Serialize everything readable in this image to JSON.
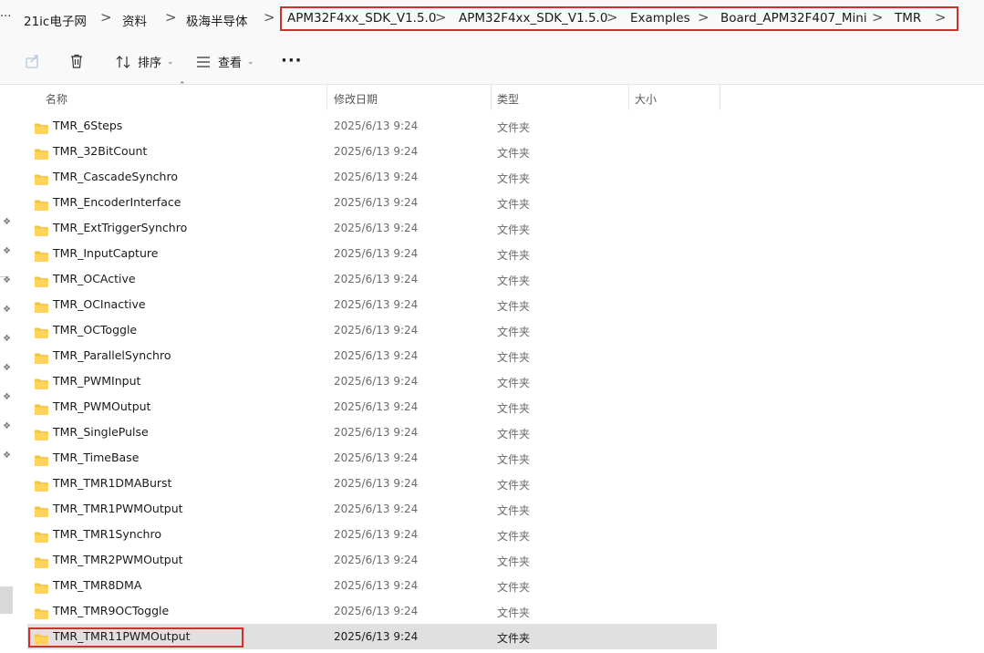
{
  "breadcrumb": {
    "overflow": "···",
    "items": [
      "21ic电子网",
      "资料",
      "极海半导体",
      "APM32F4xx_SDK_V1.5.0",
      "APM32F4xx_SDK_V1.5.0",
      "Examples",
      "Board_APM32F407_Mini",
      "TMR"
    ],
    "separator": ">"
  },
  "toolbar": {
    "sort_label": "排序",
    "view_label": "查看",
    "more_label": "···"
  },
  "columns": {
    "name": "名称",
    "modified": "修改日期",
    "type": "类型",
    "size": "大小"
  },
  "files": [
    {
      "name": "TMR_6Steps",
      "date": "2025/6/13 9:24",
      "type": "文件夹"
    },
    {
      "name": "TMR_32BitCount",
      "date": "2025/6/13 9:24",
      "type": "文件夹"
    },
    {
      "name": "TMR_CascadeSynchro",
      "date": "2025/6/13 9:24",
      "type": "文件夹"
    },
    {
      "name": "TMR_EncoderInterface",
      "date": "2025/6/13 9:24",
      "type": "文件夹"
    },
    {
      "name": "TMR_ExtTriggerSynchro",
      "date": "2025/6/13 9:24",
      "type": "文件夹"
    },
    {
      "name": "TMR_InputCapture",
      "date": "2025/6/13 9:24",
      "type": "文件夹"
    },
    {
      "name": "TMR_OCActive",
      "date": "2025/6/13 9:24",
      "type": "文件夹"
    },
    {
      "name": "TMR_OCInactive",
      "date": "2025/6/13 9:24",
      "type": "文件夹"
    },
    {
      "name": "TMR_OCToggle",
      "date": "2025/6/13 9:24",
      "type": "文件夹"
    },
    {
      "name": "TMR_ParallelSynchro",
      "date": "2025/6/13 9:24",
      "type": "文件夹"
    },
    {
      "name": "TMR_PWMInput",
      "date": "2025/6/13 9:24",
      "type": "文件夹"
    },
    {
      "name": "TMR_PWMOutput",
      "date": "2025/6/13 9:24",
      "type": "文件夹"
    },
    {
      "name": "TMR_SinglePulse",
      "date": "2025/6/13 9:24",
      "type": "文件夹"
    },
    {
      "name": "TMR_TimeBase",
      "date": "2025/6/13 9:24",
      "type": "文件夹"
    },
    {
      "name": "TMR_TMR1DMABurst",
      "date": "2025/6/13 9:24",
      "type": "文件夹"
    },
    {
      "name": "TMR_TMR1PWMOutput",
      "date": "2025/6/13 9:24",
      "type": "文件夹"
    },
    {
      "name": "TMR_TMR1Synchro",
      "date": "2025/6/13 9:24",
      "type": "文件夹"
    },
    {
      "name": "TMR_TMR2PWMOutput",
      "date": "2025/6/13 9:24",
      "type": "文件夹"
    },
    {
      "name": "TMR_TMR8DMA",
      "date": "2025/6/13 9:24",
      "type": "文件夹"
    },
    {
      "name": "TMR_TMR9OCToggle",
      "date": "2025/6/13 9:24",
      "type": "文件夹"
    },
    {
      "name": "TMR_TMR11PWMOutput",
      "date": "2025/6/13 9:24",
      "type": "文件夹",
      "selected": true
    }
  ],
  "colors": {
    "folder": "#f4c542",
    "highlight": "#d32f2f",
    "selected_row": "#e0e0e0"
  }
}
